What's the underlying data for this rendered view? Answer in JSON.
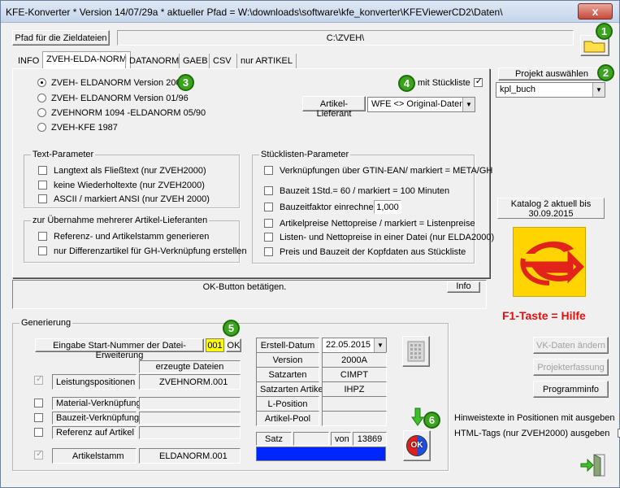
{
  "window": {
    "title": "KFE-Konverter * Version 14/07/29a * aktueller Pfad = W:\\downloads\\software\\kfe_konverter\\KFEViewerCD2\\Daten\\",
    "close": "x"
  },
  "path": {
    "label": "Pfad für die Zieldateien",
    "value": "C:\\ZVEH\\"
  },
  "tabs": [
    "INFO",
    "ZVEH-ELDA-NORM",
    "DATANORM",
    "GAEB",
    "CSV",
    "nur ARTIKEL"
  ],
  "badges": [
    "1",
    "2",
    "3",
    "4",
    "5",
    "6"
  ],
  "versions": [
    {
      "label": "ZVEH- ELDANORM Version 2000",
      "selected": true
    },
    {
      "label": "ZVEH- ELDANORM Version 01/96",
      "selected": false
    },
    {
      "label": "ZVEHNORM 1094 -ELDANORM 05/90",
      "selected": false
    },
    {
      "label": "ZVEH-KFE 1987",
      "selected": false
    }
  ],
  "stueckliste": {
    "label": "mit Stückliste",
    "checked": true
  },
  "lieferant": {
    "label": "Artikel-Lieferant",
    "value": "WFE  <> Original-Daten de"
  },
  "text_params": {
    "title": "Text-Parameter",
    "items": [
      "Langtext als Fließtext (nur ZVEH2000)",
      "keine Wiederholtexte (nur ZVEH2000)",
      "ASCII / markiert ANSI (nur ZVEH 2000)"
    ]
  },
  "multi_lieferanten": {
    "title": "zur Übernahme mehrerer Artikel-Lieferanten",
    "items": [
      "Referenz- und Artikelstamm generieren",
      "nur Differenzartikel für GH-Verknüpfung erstellen"
    ]
  },
  "stueckliste_params": {
    "title": "Stücklisten-Parameter",
    "items": [
      "Verknüpfungen über GTIN-EAN/ markiert = META/GH",
      "Bauzeit 1Std.= 60 / markiert = 100 Minuten",
      "Bauzeitfaktor einrechnen",
      "Artikelpreise  Nettopreise / markiert = Listenpreise",
      "Listen- und Nettopreise in einer Datei (nur ELDA2000)",
      "Preis und Bauzeit der Kopfdaten aus Stückliste"
    ],
    "factor": "1,000"
  },
  "projekt": {
    "button": "Projekt auswählen",
    "value": "kpl_buch"
  },
  "katalog": {
    "line1": "Katalog 2 aktuell bis",
    "line2": "30.09.2015"
  },
  "help": "F1-Taste = Hilfe",
  "status": {
    "message": "OK-Button betätigen.",
    "info": "Info"
  },
  "generierung": {
    "title": "Generierung",
    "start_label": "Eingabe Start-Nummer der Datei-Erweiterung",
    "start_value": "001",
    "ok": "OK",
    "erzeugte_header": "erzeugte Dateien",
    "rows": [
      {
        "label": "Leistungspositionen",
        "file": "ZVEHNORM.001",
        "checked": true,
        "disabled": true
      },
      {
        "label": "Material-Verknüpfung",
        "file": "",
        "checked": false,
        "disabled": false
      },
      {
        "label": "Bauzeit-Verknüpfung",
        "file": "",
        "checked": false,
        "disabled": false
      },
      {
        "label": "Referenz auf Artikel",
        "file": "",
        "checked": false,
        "disabled": false
      },
      {
        "label": "Artikelstamm",
        "file": "ELDANORM.001",
        "checked": true,
        "disabled": true
      }
    ],
    "info": [
      {
        "label": "Erstell-Datum",
        "value": "22.05.2015"
      },
      {
        "label": "Version",
        "value": "2000A"
      },
      {
        "label": "Satzarten",
        "value": "CIMPT"
      },
      {
        "label": "Satzarten Artikel",
        "value": "IHPZ"
      },
      {
        "label": "L-Position",
        "value": ""
      },
      {
        "label": "Artikel-Pool",
        "value": ""
      }
    ],
    "satz_label": "Satz",
    "satz_value": "",
    "von_label": "von",
    "total": "13869",
    "ok_icon": "OK"
  },
  "right_buttons": {
    "vk": "VK-Daten ändern",
    "projekt": "Projekterfassung",
    "info": "Programminfo"
  },
  "options": [
    {
      "label": "Hinweistexte in Positionen mit ausgeben",
      "checked": true
    },
    {
      "label": "HTML-Tags (nur ZVEH2000) ausgeben",
      "checked": false
    }
  ],
  "colors": {
    "accent_green": "#3ba31d",
    "logo_yellow": "#ffd400",
    "logo_red": "#e2231a",
    "progress_blue": "#0026ff",
    "start_yellow": "#ffff00",
    "help_red": "#e3100f"
  }
}
